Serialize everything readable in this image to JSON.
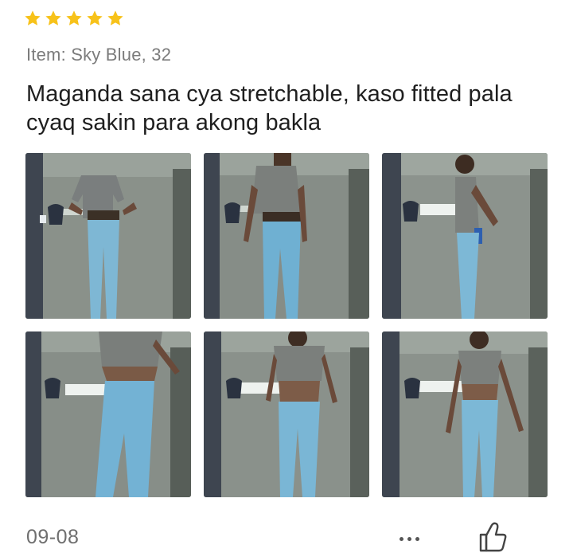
{
  "review": {
    "rating": 5,
    "item_variant": "Item: Sky Blue, 32",
    "text": "Maganda sana cya stretchable, kaso fitted pala cyaq sakin para akong bakla",
    "date": "09-08",
    "photo_count": 6
  },
  "colors": {
    "star": "#f7c21a",
    "variant_text": "#7b7b7b",
    "date_text": "#6f6f6f",
    "icon": "#555555"
  },
  "icons": {
    "more": "more-dots-icon",
    "like": "thumbs-up-icon"
  }
}
